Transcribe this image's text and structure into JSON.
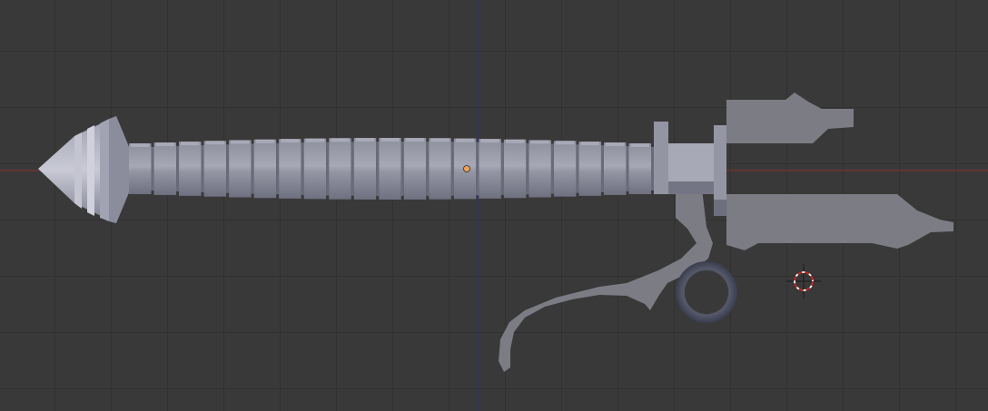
{
  "viewport": {
    "type": "3d-viewport",
    "view": "orthographic-side",
    "colors": {
      "background": "#393939",
      "grid": "#313131",
      "x_axis": "#8a3030",
      "z_axis": "#2e2e8c",
      "mesh_light": "#b7b8c6",
      "mesh_mid": "#8c8d9a",
      "mesh_dark": "#707180",
      "flat_part": "#7b7c84",
      "origin": "#f0a050",
      "cursor": "#cc2222"
    }
  },
  "scene": {
    "object": {
      "parts": [
        "tip-cone",
        "ribbed-barrel",
        "collar",
        "clamp-jaws",
        "lever-arm",
        "ring"
      ],
      "barrel_segment_count": 21
    },
    "cursor_icon": "3d-cursor-icon",
    "origin_icon": "object-origin-icon"
  }
}
